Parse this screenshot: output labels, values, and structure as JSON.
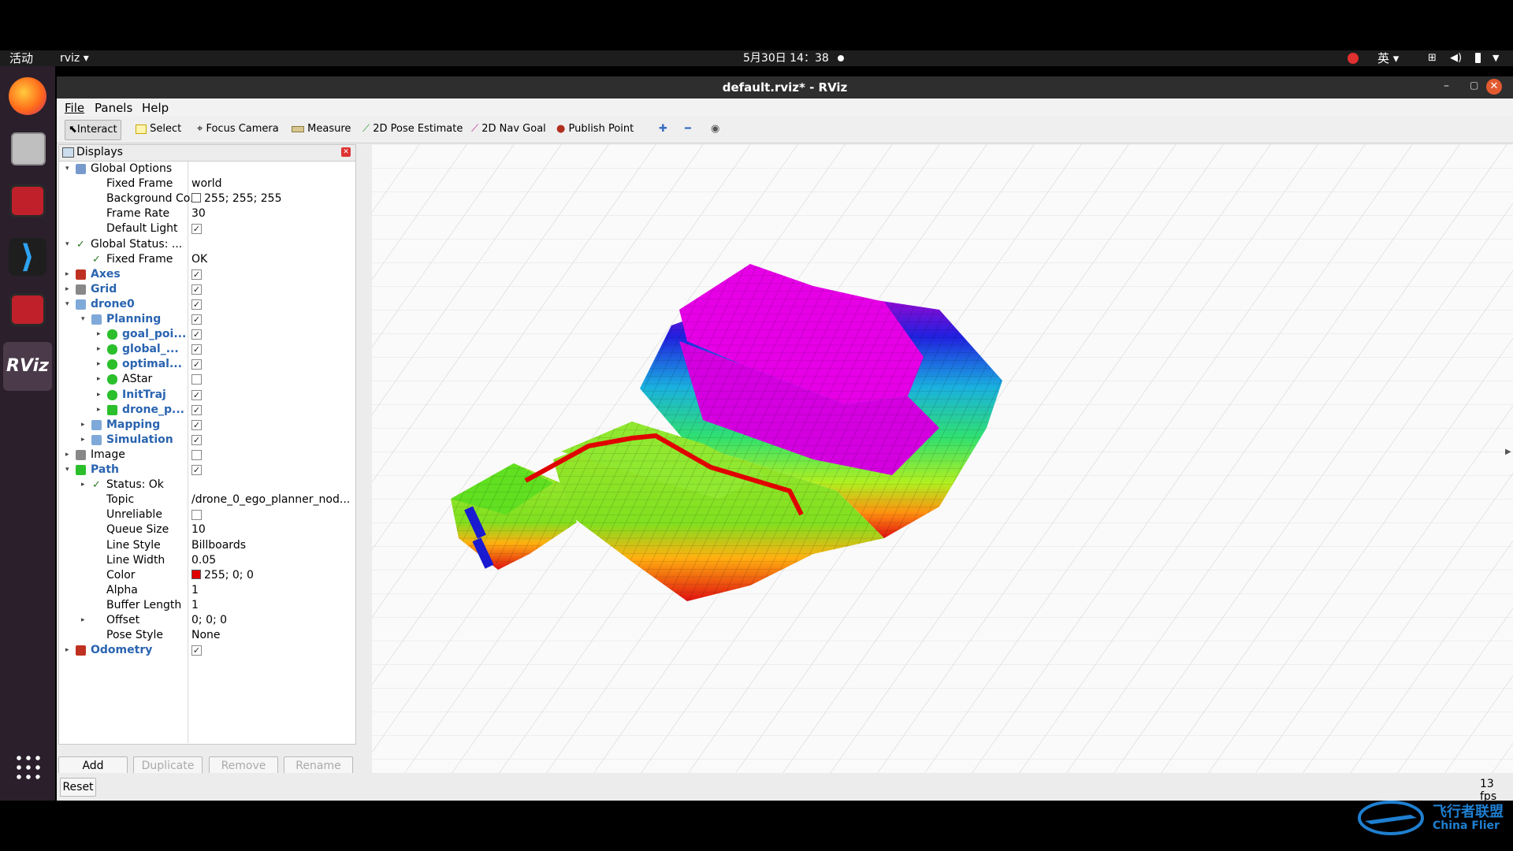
{
  "topbar": {
    "activities": "活动",
    "app": "rviz ▾",
    "clock": "5月30日 14：38",
    "lang": "英 ▾"
  },
  "window": {
    "title": "default.rviz* - RViz"
  },
  "menu": {
    "file": "File",
    "panels": "Panels",
    "help": "Help"
  },
  "toolbar": {
    "interact": "Interact",
    "select": "Select",
    "focus": "Focus Camera",
    "measure": "Measure",
    "pose": "2D Pose Estimate",
    "nav": "2D Nav Goal",
    "publish": "Publish Point"
  },
  "displays": {
    "title": "Displays",
    "rows": [
      {
        "label": "Global Options",
        "value": "",
        "style": "normal"
      },
      {
        "label": "Fixed Frame",
        "value": "world"
      },
      {
        "label": "Background Co...",
        "value": "255; 255; 255"
      },
      {
        "label": "Frame Rate",
        "value": "30"
      },
      {
        "label": "Default Light",
        "value": "✓"
      },
      {
        "label": "Global Status: ...",
        "value": ""
      },
      {
        "label": "Fixed Frame",
        "value": "OK"
      },
      {
        "label": "Axes",
        "value": "✓"
      },
      {
        "label": "Grid",
        "value": "✓"
      },
      {
        "label": "drone0",
        "value": "✓"
      },
      {
        "label": "Planning",
        "value": "✓"
      },
      {
        "label": "goal_poi...",
        "value": "✓"
      },
      {
        "label": "global_...",
        "value": "✓"
      },
      {
        "label": "optimal...",
        "value": "✓"
      },
      {
        "label": "AStar",
        "value": ""
      },
      {
        "label": "InitTraj",
        "value": "✓"
      },
      {
        "label": "drone_p...",
        "value": "✓"
      },
      {
        "label": "Mapping",
        "value": "✓"
      },
      {
        "label": "Simulation",
        "value": "✓"
      },
      {
        "label": "Image",
        "value": ""
      },
      {
        "label": "Path",
        "value": "✓"
      },
      {
        "label": "Status: Ok",
        "value": ""
      },
      {
        "label": "Topic",
        "value": "/drone_0_ego_planner_nod..."
      },
      {
        "label": "Unreliable",
        "value": ""
      },
      {
        "label": "Queue Size",
        "value": "10"
      },
      {
        "label": "Line Style",
        "value": "Billboards"
      },
      {
        "label": "Line Width",
        "value": "0.05"
      },
      {
        "label": "Color",
        "value": "255; 0; 0"
      },
      {
        "label": "Alpha",
        "value": "1"
      },
      {
        "label": "Buffer Length",
        "value": "1"
      },
      {
        "label": "Offset",
        "value": "0; 0; 0"
      },
      {
        "label": "Pose Style",
        "value": "None"
      },
      {
        "label": "Odometry",
        "value": "✓"
      }
    ],
    "buttons": {
      "add": "Add",
      "duplicate": "Duplicate",
      "remove": "Remove",
      "rename": "Rename"
    }
  },
  "status": {
    "reset": "Reset",
    "fps": "13 fps"
  },
  "watermark": {
    "cn": "飞行者联盟",
    "en": "China Flier"
  },
  "colors": {
    "path": "#e00000",
    "voxel_top": "#e600e6"
  }
}
